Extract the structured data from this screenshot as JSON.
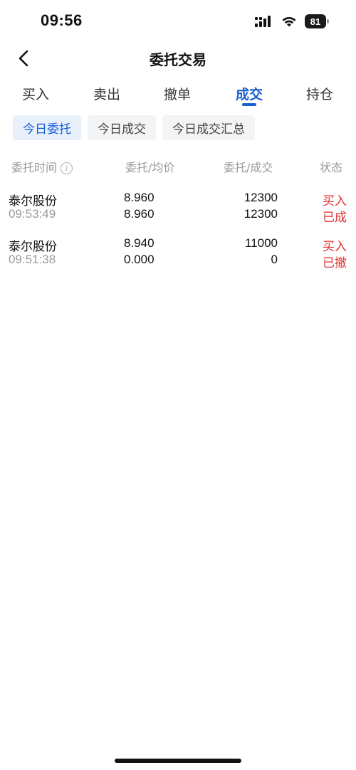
{
  "status_bar": {
    "time": "09:56",
    "battery": "81",
    "icons": [
      "signal-icon",
      "wifi-icon",
      "battery-icon"
    ]
  },
  "nav": {
    "title": "委托交易",
    "back_icon": "chevron-left-icon"
  },
  "tabs": [
    {
      "label": "买入",
      "active": false
    },
    {
      "label": "卖出",
      "active": false
    },
    {
      "label": "撤单",
      "active": false
    },
    {
      "label": "成交",
      "active": true
    },
    {
      "label": "持仓",
      "active": false
    }
  ],
  "sub_tabs": [
    {
      "label": "今日委托",
      "active": true
    },
    {
      "label": "今日成交",
      "active": false
    },
    {
      "label": "今日成交汇总",
      "active": false
    }
  ],
  "table": {
    "headers": [
      "委托时间",
      "委托/均价",
      "委托/成交",
      "状态"
    ],
    "info_icon": "info-icon",
    "rows": [
      {
        "name": "泰尔股份",
        "time": "09:53:49",
        "order_price": "8.960",
        "avg_price": "8.960",
        "order_qty": "12300",
        "filled_qty": "12300",
        "direction": "买入",
        "status": "已成"
      },
      {
        "name": "泰尔股份",
        "time": "09:51:38",
        "order_price": "8.940",
        "avg_price": "0.000",
        "order_qty": "11000",
        "filled_qty": "0",
        "direction": "买入",
        "status": "已撤"
      }
    ]
  },
  "colors": {
    "accent": "#1a5ed6",
    "buy": "#e03030",
    "muted": "#9a9a9a"
  }
}
